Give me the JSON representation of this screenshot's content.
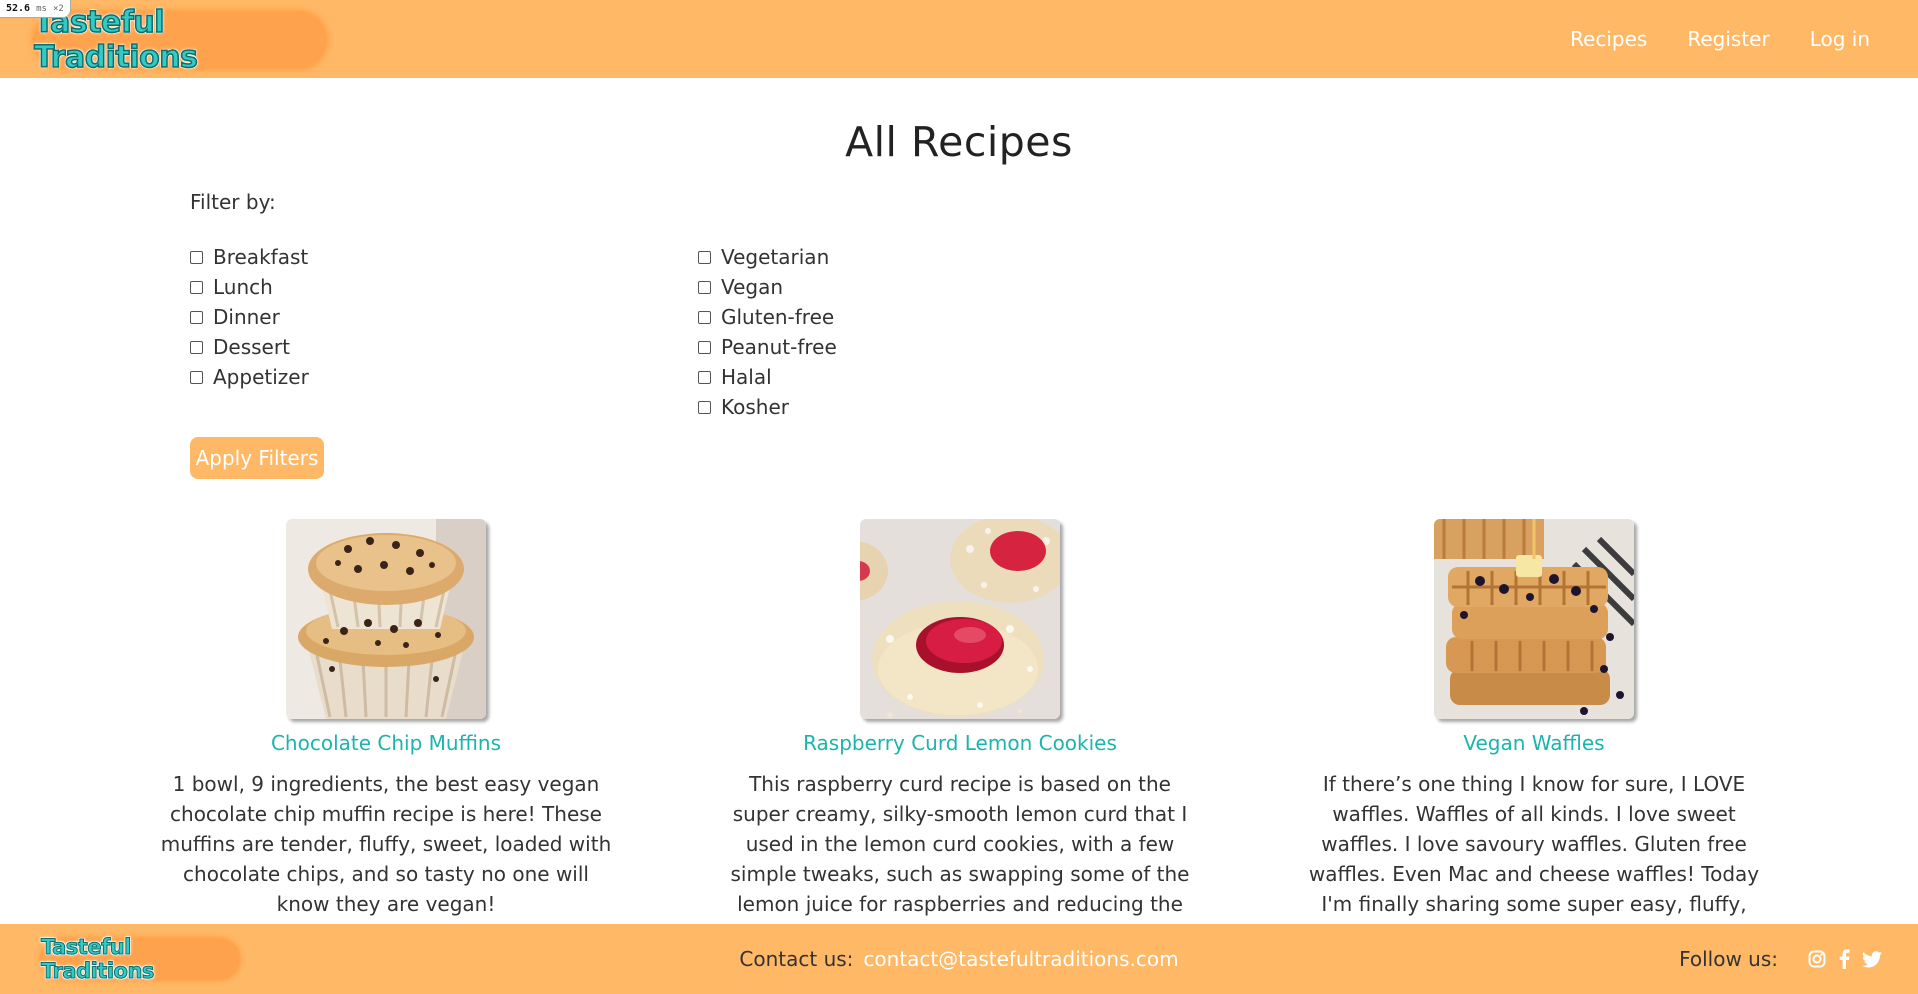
{
  "overlay": {
    "value": "52.6",
    "unit": "ms",
    "multiplier": "×2"
  },
  "brand": {
    "name": "Tasteful Traditions"
  },
  "nav": {
    "items": [
      {
        "label": "Recipes"
      },
      {
        "label": "Register"
      },
      {
        "label": "Log in"
      }
    ]
  },
  "page": {
    "title": "All Recipes"
  },
  "filters": {
    "label": "Filter by:",
    "meal_types": [
      "Breakfast",
      "Lunch",
      "Dinner",
      "Dessert",
      "Appetizer"
    ],
    "diets": [
      "Vegetarian",
      "Vegan",
      "Gluten-free",
      "Peanut-free",
      "Halal",
      "Kosher"
    ],
    "apply_label": "Apply Filters"
  },
  "recipes": [
    {
      "title": "Chocolate Chip Muffins",
      "description": "1 bowl, 9 ingredients, the best easy vegan chocolate chip muffin recipe is here! These muffins are tender, fluffy, sweet, loaded with chocolate chips, and so tasty no one will know they are vegan!",
      "image": "chocolate-chip-muffins-photo"
    },
    {
      "title": "Raspberry Curd Lemon Cookies",
      "description": "This raspberry curd recipe is based on the super creamy, silky-smooth lemon curd that I used in the lemon curd cookies, with a few simple tweaks, such as swapping some of the lemon juice for raspberries and reducing the",
      "image": "raspberry-lemon-cookies-photo"
    },
    {
      "title": "Vegan Waffles",
      "description": "If there’s one thing I know for sure, I LOVE waffles. Waffles of all kinds. I love sweet waffles. I love savoury waffles. Gluten free waffles. Even Mac and cheese waffles! Today I'm finally sharing some super easy, fluffy, classic",
      "image": "vegan-waffles-photo"
    }
  ],
  "footer": {
    "contact_label": "Contact us:",
    "email": "contact@tastefultraditions.com",
    "follow_label": "Follow us:",
    "social_icons": [
      "instagram-icon",
      "facebook-icon",
      "twitter-icon"
    ]
  },
  "colors": {
    "header": "#ffb866",
    "accent": "#1cb5ad",
    "button": "#ffb866"
  }
}
